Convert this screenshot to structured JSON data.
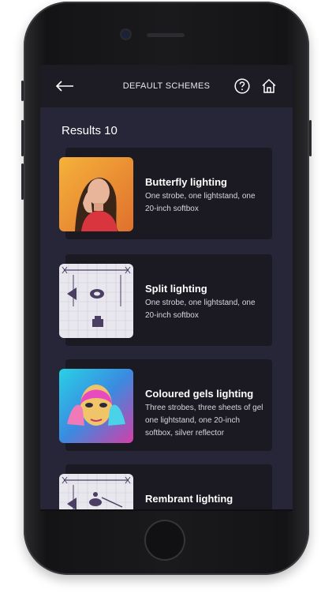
{
  "header": {
    "title": "DEFAULT SCHEMES",
    "back_icon": "arrow-left-icon",
    "help_icon": "question-icon",
    "home_icon": "home-icon"
  },
  "results": {
    "label": "Results 10"
  },
  "items": [
    {
      "title": "Butterfly lighting",
      "desc": "One strobe, one lightstand, one 20-inch softbox",
      "thumb": "portrait-photo"
    },
    {
      "title": "Split lighting",
      "desc": "One strobe, one lightstand, one 20-inch softbox",
      "thumb": "lighting-diagram"
    },
    {
      "title": "Coloured gels lighting",
      "desc": "Three strobes, three sheets of gel one lightstand, one 20-inch softbox, silver reflector",
      "thumb": "portrait-photo"
    },
    {
      "title": "Rembrant lighting",
      "desc": "",
      "thumb": "lighting-diagram"
    }
  ],
  "colors": {
    "screen_bg": "#262638",
    "topbar_bg": "#1d1b24",
    "card_bg": "#1b1a22"
  }
}
